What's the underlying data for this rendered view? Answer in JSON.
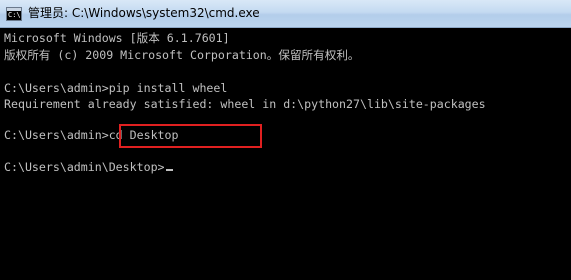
{
  "window": {
    "title": "管理员: C:\\Windows\\system32\\cmd.exe",
    "icon": "cmd-icon",
    "icon_glyph": "C:\\"
  },
  "console": {
    "lines": [
      "Microsoft Windows [版本 6.1.7601]",
      "版权所有 (c) 2009 Microsoft Corporation。保留所有权利。",
      "",
      "C:\\Users\\admin>pip install wheel",
      "Requirement already satisfied: wheel in d:\\python27\\lib\\site-packages",
      "",
      "C:\\Users\\admin>cd Desktop",
      "",
      "C:\\Users\\admin\\Desktop>"
    ]
  },
  "colors": {
    "console_bg": "#000000",
    "console_text": "#c0c0c0",
    "highlight_border": "#e02020"
  }
}
